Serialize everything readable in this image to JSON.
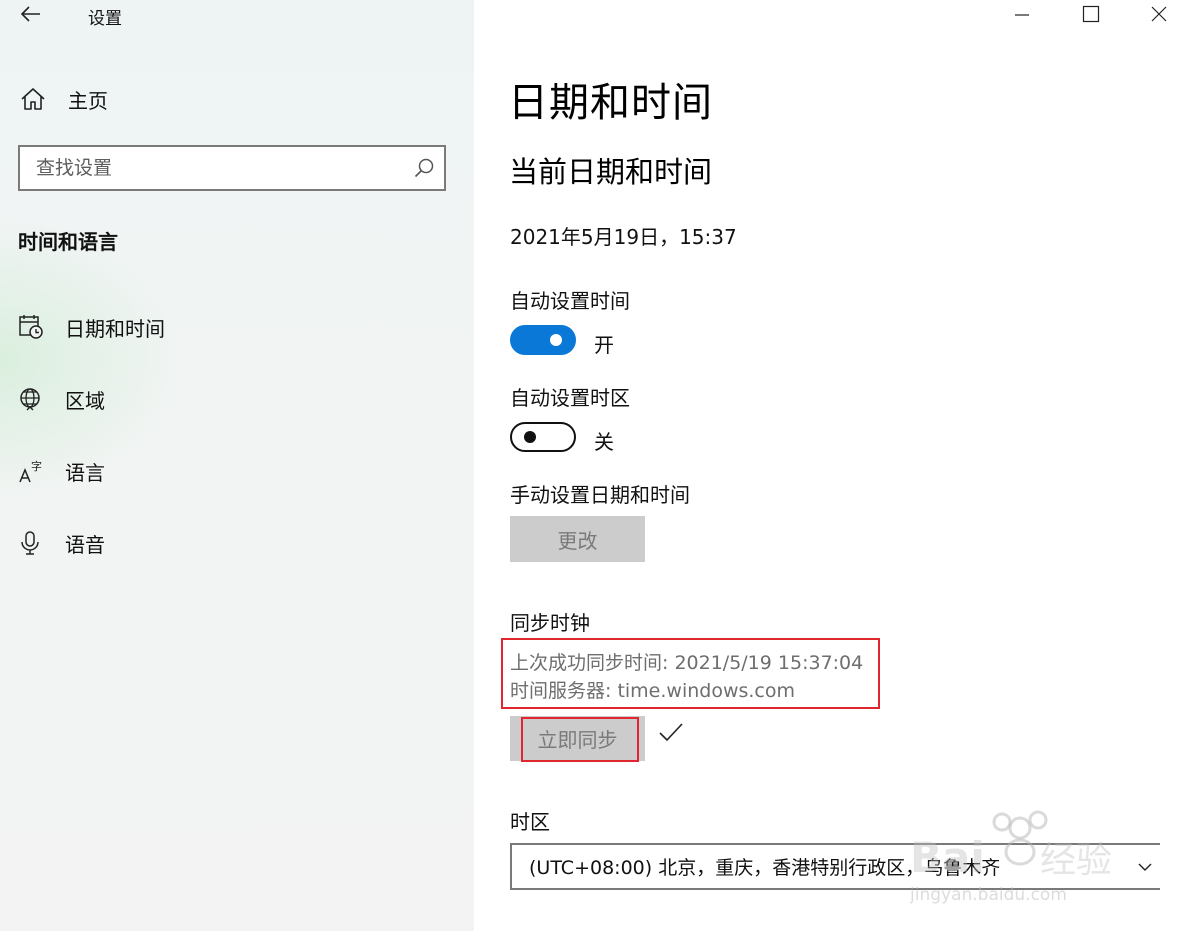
{
  "app": {
    "title": "设置"
  },
  "sidebar": {
    "home_label": "主页",
    "search_placeholder": "查找设置",
    "section_heading": "时间和语言",
    "items": [
      {
        "label": "日期和时间",
        "icon": "calendar-clock-icon"
      },
      {
        "label": "区域",
        "icon": "globe-region-icon"
      },
      {
        "label": "语言",
        "icon": "language-icon"
      },
      {
        "label": "语音",
        "icon": "microphone-icon"
      }
    ]
  },
  "main": {
    "page_title": "日期和时间",
    "section_title": "当前日期和时间",
    "current_datetime": "2021年5月19日，15:37",
    "auto_time": {
      "label": "自动设置时间",
      "state": "开",
      "on": true
    },
    "auto_timezone": {
      "label": "自动设置时区",
      "state": "关",
      "on": false
    },
    "manual": {
      "label": "手动设置日期和时间",
      "button": "更改"
    },
    "sync": {
      "label": "同步时钟",
      "last_sync": "上次成功同步时间: 2021/5/19 15:37:04",
      "server": "时间服务器: time.windows.com",
      "button": "立即同步"
    },
    "timezone": {
      "label": "时区",
      "value": "(UTC+08:00) 北京，重庆，香港特别行政区，乌鲁木齐"
    }
  },
  "colors": {
    "accent": "#0a78d7",
    "highlight": "#e0262f",
    "disabled_bg": "#cccccc"
  },
  "watermark": {
    "text": "Baidu经验",
    "sub": "jingyan.baidu.com"
  }
}
